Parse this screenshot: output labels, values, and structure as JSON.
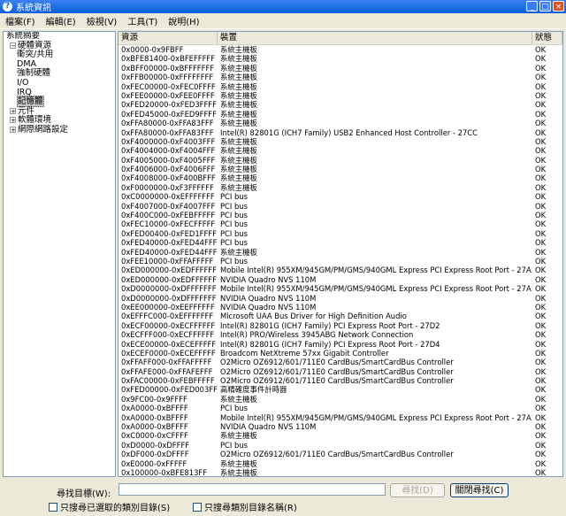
{
  "window": {
    "title": "系統資訊",
    "min": "_",
    "max": "□",
    "close": "×"
  },
  "menu": [
    "檔案(F)",
    "編輯(E)",
    "檢視(V)",
    "工具(T)",
    "說明(H)"
  ],
  "tree": [
    {
      "label": "系統摘要",
      "indent": 0,
      "exp": ""
    },
    {
      "label": "硬體資源",
      "indent": 1,
      "exp": "−"
    },
    {
      "label": "衝突/共用",
      "indent": 3,
      "exp": ""
    },
    {
      "label": "DMA",
      "indent": 3,
      "exp": ""
    },
    {
      "label": "強制硬體",
      "indent": 3,
      "exp": ""
    },
    {
      "label": "I/O",
      "indent": 3,
      "exp": ""
    },
    {
      "label": "IRQ",
      "indent": 3,
      "exp": ""
    },
    {
      "label": "記憶體",
      "indent": 3,
      "exp": "",
      "selected": true
    },
    {
      "label": "元件",
      "indent": 1,
      "exp": "+"
    },
    {
      "label": "軟體環境",
      "indent": 1,
      "exp": "+"
    },
    {
      "label": "網際網路設定",
      "indent": 1,
      "exp": "+"
    }
  ],
  "columns": {
    "resource": "資源",
    "device": "裝置",
    "status": "狀態"
  },
  "rows": [
    [
      "0x0000-0x9FBFF",
      "系統主機板",
      "OK"
    ],
    [
      "0xBFE81400-0xBFEFFFFF",
      "系統主機板",
      "OK"
    ],
    [
      "0xBFF00000-0xBFFFFFFF",
      "系統主機板",
      "OK"
    ],
    [
      "0xFFB00000-0xFFFFFFFF",
      "系統主機板",
      "OK"
    ],
    [
      "0xFEC00000-0xFEC0FFFF",
      "系統主機板",
      "OK"
    ],
    [
      "0xFEE00000-0xFEE0FFFF",
      "系統主機板",
      "OK"
    ],
    [
      "0xFED20000-0xFED3FFFF",
      "系統主機板",
      "OK"
    ],
    [
      "0xFED45000-0xFED9FFFF",
      "系統主機板",
      "OK"
    ],
    [
      "0xFFA80000-0xFFA83FFF",
      "系統主機板",
      "OK"
    ],
    [
      "0xFFA80000-0xFFA83FFF",
      "Intel(R) 82801G (ICH7 Family) USB2 Enhanced Host Controller - 27CC",
      "OK"
    ],
    [
      "0xF4000000-0xF4003FFF",
      "系統主機板",
      "OK"
    ],
    [
      "0xF4004000-0xF4004FFF",
      "系統主機板",
      "OK"
    ],
    [
      "0xF4005000-0xF4005FFF",
      "系統主機板",
      "OK"
    ],
    [
      "0xF4006000-0xF4006FFF",
      "系統主機板",
      "OK"
    ],
    [
      "0xF4008000-0xF400BFFF",
      "系統主機板",
      "OK"
    ],
    [
      "0xF0000000-0xF3FFFFFF",
      "系統主機板",
      "OK"
    ],
    [
      "0xC0000000-0xEFFFFFFF",
      "PCI bus",
      "OK"
    ],
    [
      "0xF4007000-0xF4007FFF",
      "PCI bus",
      "OK"
    ],
    [
      "0xF400C000-0xFEBFFFFF",
      "PCI bus",
      "OK"
    ],
    [
      "0xFEC10000-0xFECFFFFF",
      "PCI bus",
      "OK"
    ],
    [
      "0xFED00400-0xFED1FFFF",
      "PCI bus",
      "OK"
    ],
    [
      "0xFED40000-0xFED44FFF",
      "PCI bus",
      "OK"
    ],
    [
      "0xFED40000-0xFED44FFF",
      "系統主機板",
      "OK"
    ],
    [
      "0xFEE10000-0xFFAFFFFF",
      "PCI bus",
      "OK"
    ],
    [
      "0xED000000-0xEDFFFFFF",
      "Mobile Intel(R) 955XM/945GM/PM/GMS/940GML Express PCI Express Root Port - 27A1",
      "OK"
    ],
    [
      "0xED000000-0xEDFFFFFF",
      "NVIDIA Quadro NVS 110M",
      "OK"
    ],
    [
      "0xD0000000-0xDFFFFFFF",
      "Mobile Intel(R) 955XM/945GM/PM/GMS/940GML Express PCI Express Root Port - 27A1",
      "OK"
    ],
    [
      "0xD0000000-0xDFFFFFFF",
      "NVIDIA Quadro NVS 110M",
      "OK"
    ],
    [
      "0xEE000000-0xEEFFFFFF",
      "NVIDIA Quadro NVS 110M",
      "OK"
    ],
    [
      "0xEFFFC000-0xEFFFFFFF",
      "Microsoft UAA Bus Driver for High Definition Audio",
      "OK"
    ],
    [
      "0xECF00000-0xECFFFFFF",
      "Intel(R) 82801G (ICH7 Family) PCI Express Root Port - 27D2",
      "OK"
    ],
    [
      "0xECFFF000-0xECFFFFFF",
      "Intel(R) PRO/Wireless 3945ABG Network Connection",
      "OK"
    ],
    [
      "0xECE00000-0xECEFFFFF",
      "Intel(R) 82801G (ICH7 Family) PCI Express Root Port - 27D4",
      "OK"
    ],
    [
      "0xECEF0000-0xECEFFFFF",
      "Broadcom NetXtreme 57xx Gigabit Controller",
      "OK"
    ],
    [
      "0xFFAFF000-0xFFAFFFFF",
      "O2Micro OZ6912/601/711E0 CardBus/SmartCardBus Controller",
      "OK"
    ],
    [
      "0xFFAFE000-0xFFAFEFFF",
      "O2Micro OZ6912/601/711E0 CardBus/SmartCardBus Controller",
      "OK"
    ],
    [
      "0xFAC00000-0xFEBFFFFF",
      "O2Micro OZ6912/601/711E0 CardBus/SmartCardBus Controller",
      "OK"
    ],
    [
      "0xFED00000-0xFED003FF",
      "高精確度事件計時器",
      "OK"
    ],
    [
      "0x9FC00-0x9FFFF",
      "系統主機板",
      "OK"
    ],
    [
      "0xA0000-0xBFFFF",
      "PCI bus",
      "OK"
    ],
    [
      "0xA0000-0xBFFFF",
      "Mobile Intel(R) 955XM/945GM/PM/GMS/940GML Express PCI Express Root Port - 27A1",
      "OK"
    ],
    [
      "0xA0000-0xBFFFF",
      "NVIDIA Quadro NVS 110M",
      "OK"
    ],
    [
      "0xC0000-0xCFFFF",
      "系統主機板",
      "OK"
    ],
    [
      "0xD0000-0xDFFFF",
      "PCI bus",
      "OK"
    ],
    [
      "0xDF000-0xDFFFF",
      "O2Micro OZ6912/601/711E0 CardBus/SmartCardBus Controller",
      "OK"
    ],
    [
      "0xE0000-0xFFFFF",
      "系統主機板",
      "OK"
    ],
    [
      "0x100000-0xBFE813FF",
      "系統主機板",
      "OK"
    ]
  ],
  "find": {
    "label": "尋找目標(W):",
    "value": "",
    "find_button": "尋找(D)",
    "close_button": "關閉尋找(C)",
    "opt1": "只搜尋已選取的類別目錄(S)",
    "opt2": "只搜尋類別目錄名稱(R)"
  }
}
